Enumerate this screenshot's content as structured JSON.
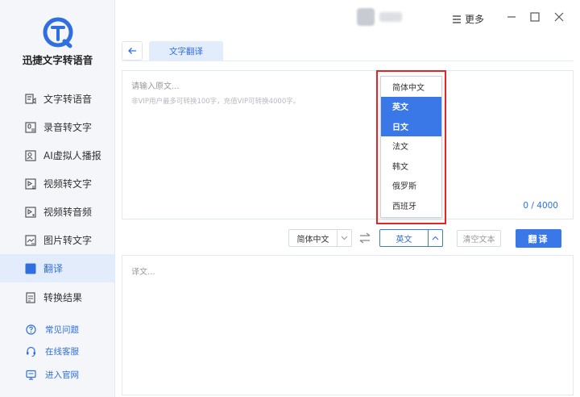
{
  "app": {
    "name": "迅捷文字转语音",
    "accent_color": "#3a78e8"
  },
  "sidebar": {
    "items": [
      {
        "label": "文字转语音",
        "icon": "text-to-speech-icon"
      },
      {
        "label": "录音转文字",
        "icon": "record-to-text-icon"
      },
      {
        "label": "AI虚拟人播报",
        "icon": "ai-avatar-icon"
      },
      {
        "label": "视频转文字",
        "icon": "video-to-text-icon"
      },
      {
        "label": "视频转音频",
        "icon": "video-to-audio-icon"
      },
      {
        "label": "图片转文字",
        "icon": "image-to-text-icon"
      },
      {
        "label": "翻译",
        "icon": "translate-icon",
        "active": true
      },
      {
        "label": "转换结果",
        "icon": "results-icon"
      }
    ],
    "help": [
      {
        "label": "常见问题",
        "icon": "question-icon"
      },
      {
        "label": "在线客服",
        "icon": "headset-icon"
      },
      {
        "label": "进入官网",
        "icon": "monitor-icon"
      }
    ]
  },
  "titlebar": {
    "more_label": "更多"
  },
  "tabs": {
    "active_label": "文字翻译"
  },
  "source": {
    "placeholder": "请输入原文...",
    "hint": "非VIP用户最多可转换100字，充值VIP可转换4000字。",
    "counter": "0 / 4000"
  },
  "dropdown": {
    "options": [
      "简体中文",
      "英文",
      "日文",
      "法文",
      "韩文",
      "俄罗斯",
      "西班牙"
    ],
    "selected": [
      "英文",
      "日文"
    ]
  },
  "controls": {
    "source_lang": "简体中文",
    "target_lang": "英文",
    "clear_label": "清空文本",
    "translate_label": "翻译"
  },
  "result": {
    "placeholder": "译文..."
  }
}
